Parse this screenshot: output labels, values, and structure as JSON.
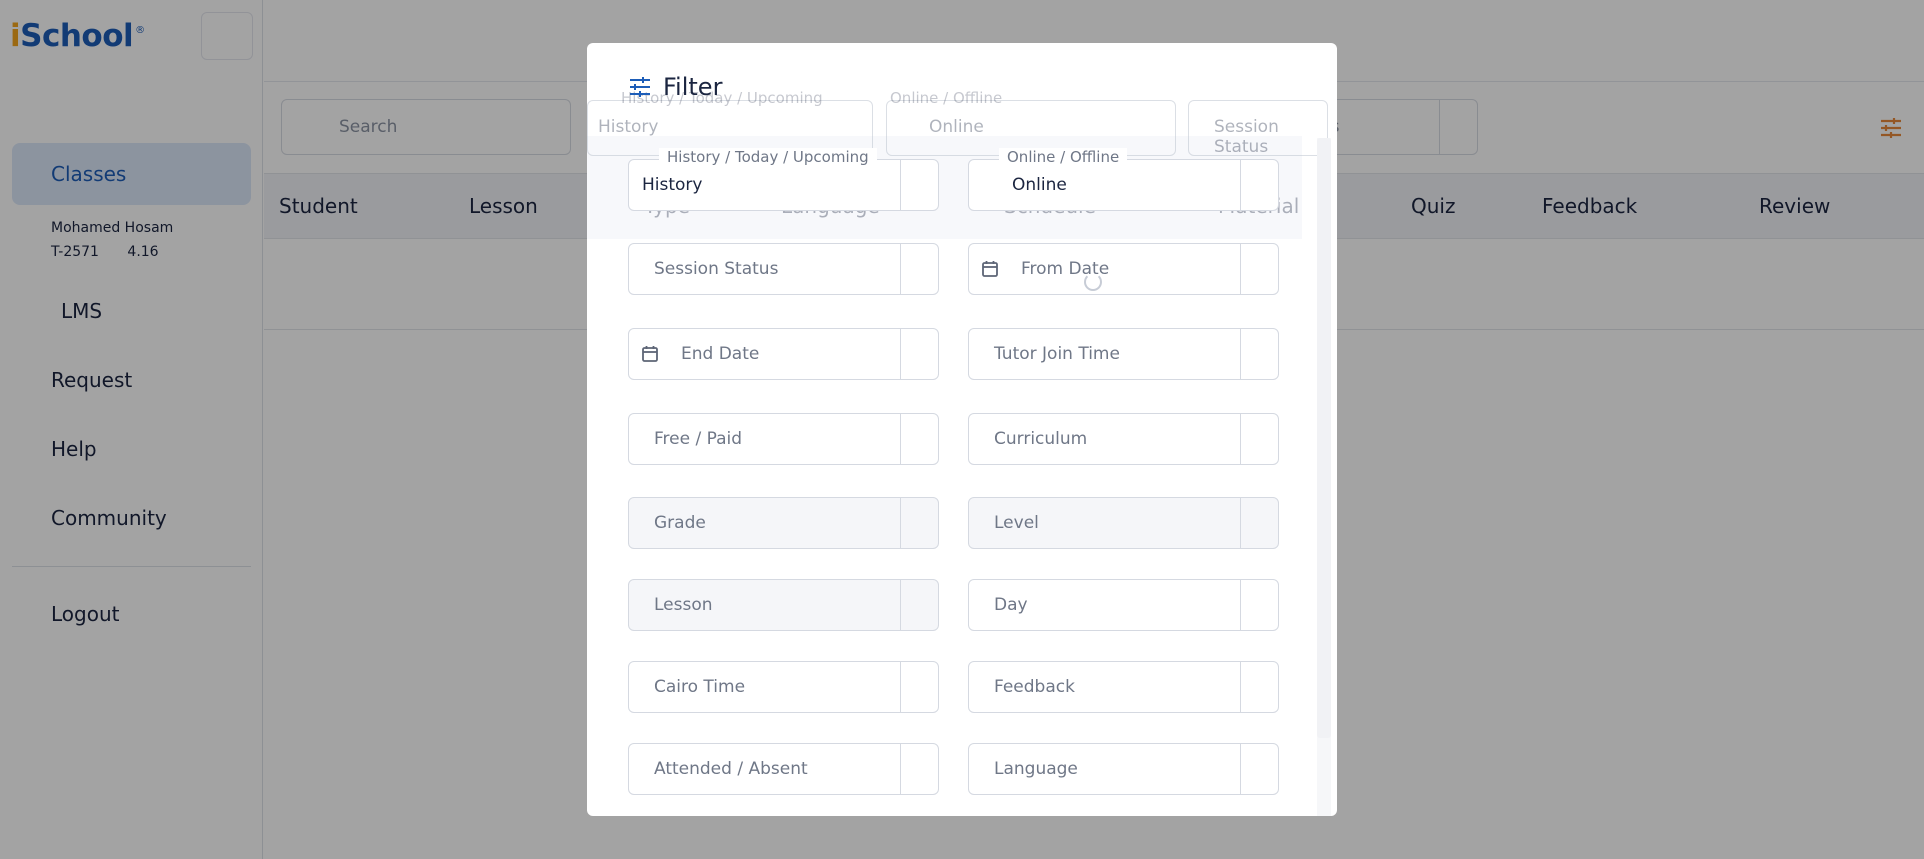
{
  "brand": {
    "name_i": "i",
    "name_rest": "School",
    "reg": "®"
  },
  "sidebar": {
    "items": [
      {
        "label": "Classes"
      },
      {
        "label": "LMS"
      },
      {
        "label": "Request"
      },
      {
        "label": "Help"
      },
      {
        "label": "Community"
      },
      {
        "label": "Logout"
      }
    ],
    "user": {
      "name": "Mohamed Hosam",
      "id": "T-2571",
      "rating": "4.16"
    }
  },
  "main": {
    "search_placeholder": "Search",
    "filters": [
      {
        "label": "History / Today / Upcoming",
        "value": "History"
      },
      {
        "label": "Online / Offline",
        "value": "Online"
      },
      {
        "label": "",
        "value": "Session Status"
      }
    ],
    "table_headers": [
      "Student",
      "Lesson",
      "Quiz",
      "Feedback",
      "Review"
    ]
  },
  "modal": {
    "title": "Filter",
    "ghost_headers": [
      "Type",
      "Language",
      "Schdeule",
      "Material"
    ],
    "fields": {
      "history": {
        "label": "History / Today / Upcoming",
        "value": "History"
      },
      "online": {
        "label": "Online / Offline",
        "value": "Online"
      },
      "session_status": "Session Status",
      "from_date": "From Date",
      "end_date": "End Date",
      "tutor_join_time": "Tutor Join Time",
      "free_paid": "Free / Paid",
      "curriculum": "Curriculum",
      "grade": "Grade",
      "level": "Level",
      "lesson": "Lesson",
      "day": "Day",
      "cairo_time": "Cairo Time",
      "feedback": "Feedback",
      "attended_absent": "Attended / Absent",
      "language": "Language"
    }
  },
  "colors": {
    "accent": "#1d5db8",
    "brand_yellow": "#f2a51d",
    "orange_icon": "#e8883a"
  }
}
